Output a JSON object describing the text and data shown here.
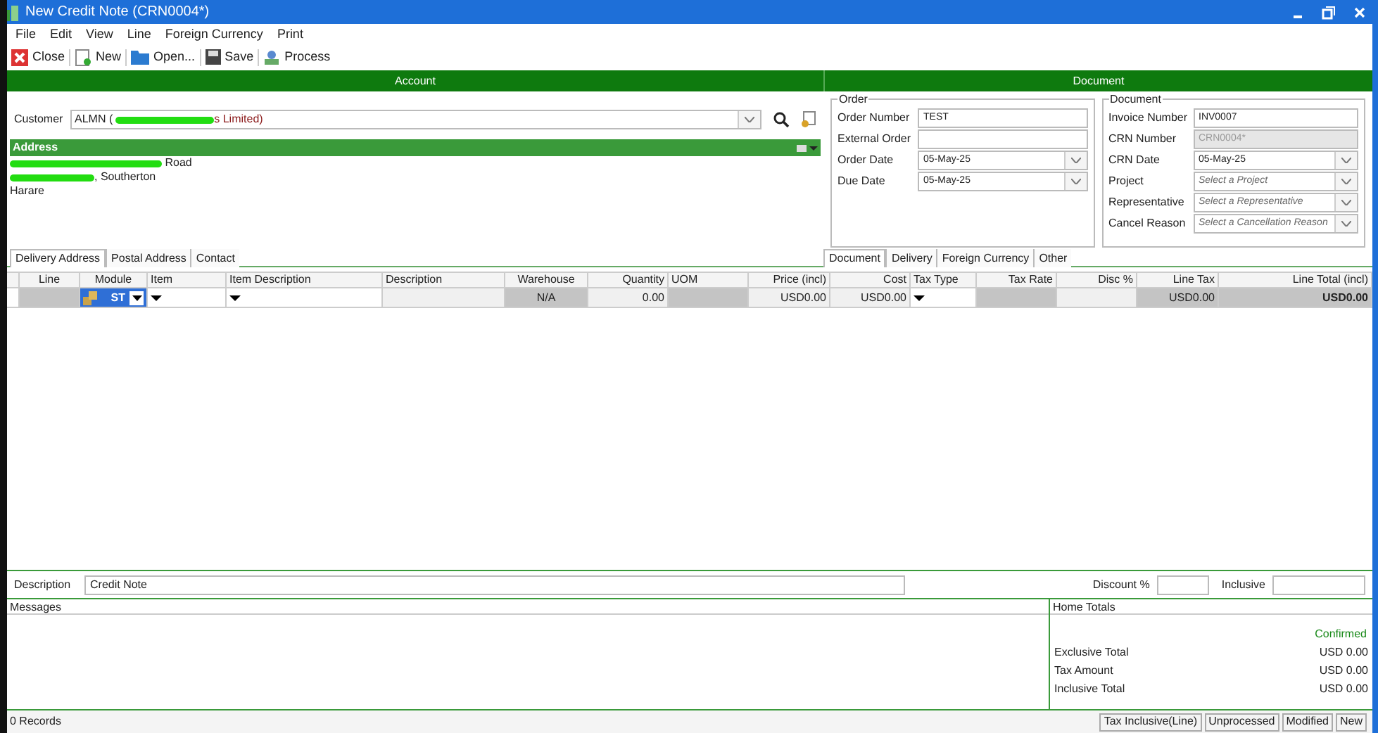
{
  "window": {
    "title": "New Credit Note (CRN0004*)"
  },
  "menu": [
    "File",
    "Edit",
    "View",
    "Line",
    "Foreign Currency",
    "Print"
  ],
  "toolbar": [
    {
      "kind": "close",
      "label": "Close"
    },
    {
      "kind": "new",
      "label": "New"
    },
    {
      "kind": "open",
      "label": "Open..."
    },
    {
      "kind": "save",
      "label": "Save"
    },
    {
      "kind": "process",
      "label": "Process"
    }
  ],
  "sections": [
    "Account",
    "Document"
  ],
  "customer": {
    "label": "Customer",
    "code": "ALMN (",
    "name_end": "s Limited)"
  },
  "address": {
    "title": "Address",
    "lines": [
      " Road",
      ", Southerton",
      "Harare"
    ]
  },
  "order": {
    "title": "Order",
    "fields": [
      {
        "label": "Order Number",
        "value": "TEST",
        "kind": "text"
      },
      {
        "label": "External Order",
        "kind": "text"
      },
      {
        "label": "Order Date",
        "value": "05-May-25",
        "kind": "select"
      },
      {
        "label": "Due Date",
        "value": "05-May-25",
        "kind": "select"
      }
    ]
  },
  "document": {
    "title": "Document",
    "fields": [
      {
        "label": "Invoice Number",
        "value": "INV0007",
        "kind": "text",
        "disabled": false
      },
      {
        "label": "CRN Number",
        "value": "CRN0004*",
        "kind": "text",
        "disabled": true
      },
      {
        "label": "CRN Date",
        "value": "05-May-25",
        "kind": "select",
        "disabled": false
      },
      {
        "label": "Project",
        "placeholder": "Select a Project",
        "kind": "select",
        "disabled": false
      },
      {
        "label": "Representative",
        "placeholder": "Select a Representative",
        "kind": "select",
        "disabled": false
      },
      {
        "label": "Cancel Reason",
        "placeholder": "Select a Cancellation Reason",
        "kind": "select",
        "disabled": false
      }
    ]
  },
  "left_tabs": [
    {
      "label": "Delivery Address",
      "selected": true
    },
    {
      "label": "Postal Address",
      "selected": false
    },
    {
      "label": "Contact",
      "selected": false
    }
  ],
  "right_tabs": [
    {
      "label": "Document",
      "selected": true
    },
    {
      "label": "Delivery",
      "selected": false
    },
    {
      "label": "Foreign Currency",
      "selected": false
    },
    {
      "label": "Other",
      "selected": false
    }
  ],
  "table": {
    "columns": [
      "Line",
      "Module",
      "Item",
      "Item Description",
      "Description",
      "Warehouse",
      "Quantity",
      "UOM",
      "Price (incl)",
      "Cost",
      "Tax Type",
      "Tax Rate",
      "Disc %",
      "Line Tax",
      "Line Total (incl)"
    ],
    "rows": [
      {
        "cells": [
          {
            "kind": "grey"
          },
          {
            "kind": "module",
            "value": "ST"
          },
          {
            "kind": "dropdown"
          },
          {
            "kind": "dropdown"
          },
          {
            "kind": "plain"
          },
          {
            "kind": "grey",
            "value": "N/A"
          },
          {
            "kind": "plain",
            "value": "0.00"
          },
          {
            "kind": "grey"
          },
          {
            "kind": "plain",
            "value": "USD0.00"
          },
          {
            "kind": "plain",
            "value": "USD0.00"
          },
          {
            "kind": "dropdown"
          },
          {
            "kind": "grey"
          },
          {
            "kind": "plain"
          },
          {
            "kind": "grey",
            "value": "USD0.00"
          },
          {
            "kind": "bold",
            "value": "USD0.00"
          }
        ]
      }
    ]
  },
  "footer": {
    "description_label": "Description",
    "description": "Credit Note",
    "discount_label": "Discount %",
    "inclusive_label": "Inclusive"
  },
  "messages": {
    "title": "Messages"
  },
  "home_totals": {
    "title": "Home Totals",
    "status": "Confirmed",
    "rows": [
      {
        "label": "Exclusive Total",
        "value": "USD 0.00"
      },
      {
        "label": "Tax Amount",
        "value": "USD 0.00"
      },
      {
        "label": "Inclusive Total",
        "value": "USD 0.00"
      }
    ]
  },
  "status_bar": {
    "records": "0 Records",
    "panels": [
      "Tax Inclusive(Line)",
      "Unprocessed",
      "Modified",
      "New"
    ]
  }
}
